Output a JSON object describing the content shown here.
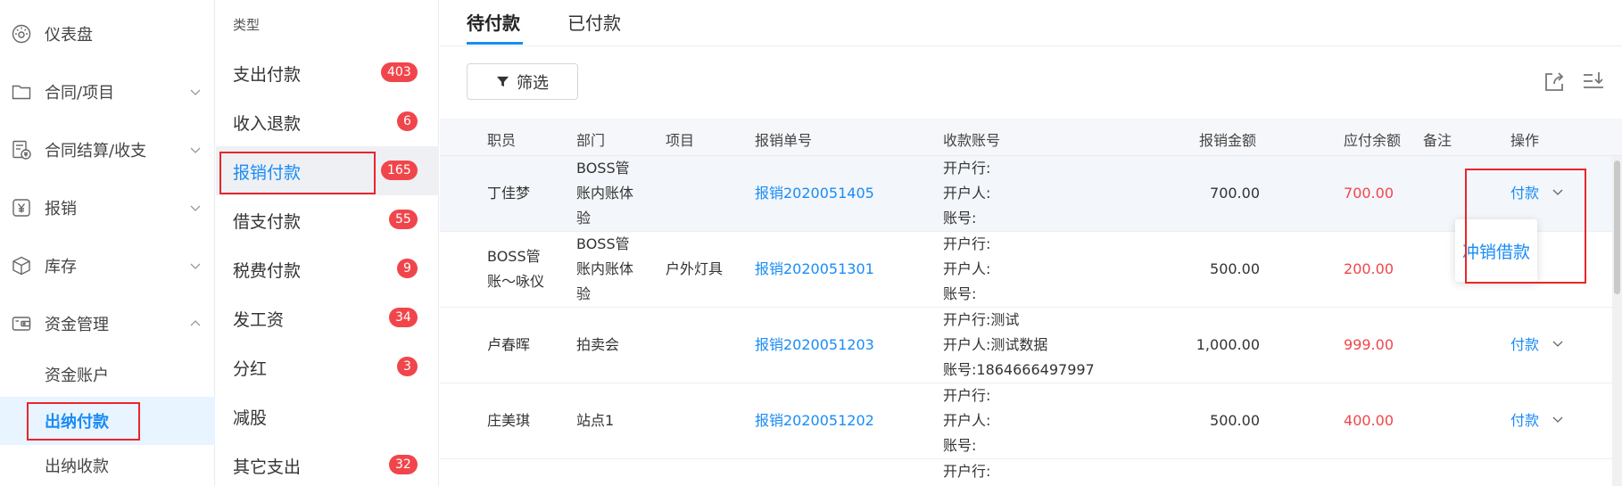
{
  "nav": {
    "items": [
      {
        "label": "仪表盘",
        "icon": "dashboard-icon"
      },
      {
        "label": "合同/项目",
        "icon": "folder-icon"
      },
      {
        "label": "合同结算/收支",
        "icon": "settlement-icon"
      },
      {
        "label": "报销",
        "icon": "yen-icon"
      },
      {
        "label": "库存",
        "icon": "box-icon"
      },
      {
        "label": "资金管理",
        "icon": "wallet-icon"
      }
    ],
    "subitems": [
      {
        "label": "资金账户"
      },
      {
        "label": "出纳付款"
      },
      {
        "label": "出纳收款"
      }
    ]
  },
  "types": {
    "header": "类型",
    "rows": [
      {
        "label": "支出付款",
        "badge": "403"
      },
      {
        "label": "收入退款",
        "badge": "6"
      },
      {
        "label": "报销付款",
        "badge": "165"
      },
      {
        "label": "借支付款",
        "badge": "55"
      },
      {
        "label": "税费付款",
        "badge": "9"
      },
      {
        "label": "发工资",
        "badge": "34"
      },
      {
        "label": "分红",
        "badge": "3"
      },
      {
        "label": "减股",
        "badge": ""
      },
      {
        "label": "其它支出",
        "badge": "32"
      }
    ]
  },
  "tabs": [
    {
      "label": "待付款"
    },
    {
      "label": "已付款"
    }
  ],
  "filter_label": "筛选",
  "table": {
    "headers": [
      "职员",
      "部门",
      "项目",
      "报销单号",
      "收款账号",
      "报销金额",
      "应付余额",
      "备注",
      "操作"
    ],
    "rows": [
      {
        "employee": "丁佳梦",
        "dept": [
          "BOSS管",
          "账内账体",
          "验"
        ],
        "project": "",
        "no": "报销2020051405",
        "acct": [
          "开户行:",
          "开户人:",
          "账号:"
        ],
        "amount": "700.00",
        "balance": "700.00",
        "note": "",
        "op": "付款"
      },
      {
        "employee": [
          "BOSS管",
          "账～咏仪"
        ],
        "dept": [
          "BOSS管",
          "账内账体",
          "验"
        ],
        "project": "户外灯具",
        "no": "报销2020051301",
        "acct": [
          "开户行:",
          "开户人:",
          "账号:"
        ],
        "amount": "500.00",
        "balance": "200.00",
        "note": "",
        "op": ""
      },
      {
        "employee": "卢春晖",
        "dept": [
          "拍卖会"
        ],
        "project": "",
        "no": "报销2020051203",
        "acct": [
          "开户行:测试",
          "开户人:测试数据",
          "账号:1864666497997"
        ],
        "amount": "1,000.00",
        "balance": "999.00",
        "note": "",
        "op": "付款"
      },
      {
        "employee": "庄美琪",
        "dept": [
          "站点1"
        ],
        "project": "",
        "no": "报销2020051202",
        "acct": [
          "开户行:",
          "开户人:",
          "账号:"
        ],
        "amount": "500.00",
        "balance": "400.00",
        "note": "",
        "op": "付款"
      },
      {
        "acct": [
          "开户行:"
        ]
      }
    ]
  },
  "dropdown_item": "冲销借款",
  "colors": {
    "accent": "#1a8cf5",
    "badge": "#f0464b",
    "highlight": "#e8262b"
  }
}
